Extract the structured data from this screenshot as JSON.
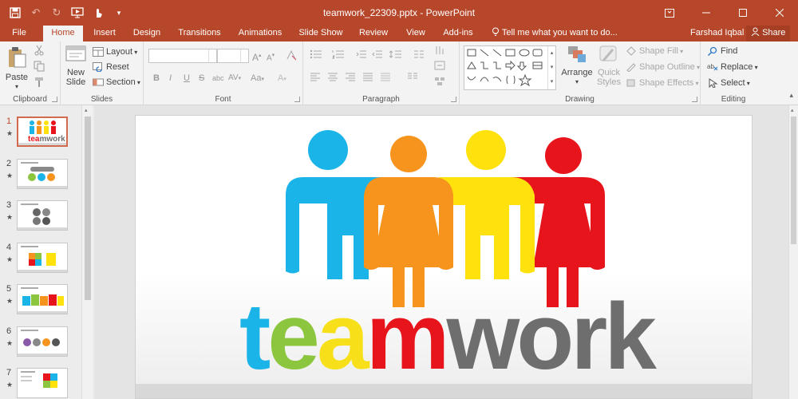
{
  "window": {
    "title": "teamwork_22309.pptx - PowerPoint",
    "controls": [
      "ribbon-display-icon",
      "minimize-icon",
      "restore-icon",
      "close-icon"
    ]
  },
  "quick_access": [
    "save-icon",
    "undo-icon",
    "redo-icon",
    "start-from-beginning-icon",
    "touch-mode-icon",
    "customize-icon"
  ],
  "tabs": [
    {
      "label": "File",
      "active": false
    },
    {
      "label": "Home",
      "active": true
    },
    {
      "label": "Insert",
      "active": false
    },
    {
      "label": "Design",
      "active": false
    },
    {
      "label": "Transitions",
      "active": false
    },
    {
      "label": "Animations",
      "active": false
    },
    {
      "label": "Slide Show",
      "active": false
    },
    {
      "label": "Review",
      "active": false
    },
    {
      "label": "View",
      "active": false
    },
    {
      "label": "Add-ins",
      "active": false
    }
  ],
  "tell_me": "Tell me what you want to do...",
  "user_name": "Farshad Iqbal",
  "share_label": "Share",
  "ribbon": {
    "clipboard": {
      "label": "Clipboard",
      "paste": "Paste"
    },
    "slides": {
      "label": "Slides",
      "new_slide_1": "New",
      "new_slide_2": "Slide",
      "layout": "Layout",
      "reset": "Reset",
      "section": "Section"
    },
    "font": {
      "label": "Font",
      "font_name": "",
      "font_size": "",
      "bold": "B",
      "italic": "I",
      "underline": "U",
      "strike": "S",
      "shadow": "abc",
      "spacing": "AV",
      "case": "Aa"
    },
    "paragraph": {
      "label": "Paragraph"
    },
    "drawing": {
      "label": "Drawing",
      "arrange": "Arrange",
      "quick_styles_1": "Quick",
      "quick_styles_2": "Styles",
      "shape_fill": "Shape Fill",
      "shape_outline": "Shape Outline",
      "shape_effects": "Shape Effects"
    },
    "editing": {
      "label": "Editing",
      "find": "Find",
      "replace": "Replace",
      "select": "Select"
    }
  },
  "thumbnails": [
    {
      "num": "1",
      "selected": true
    },
    {
      "num": "2",
      "selected": false
    },
    {
      "num": "3",
      "selected": false
    },
    {
      "num": "4",
      "selected": false
    },
    {
      "num": "5",
      "selected": false
    },
    {
      "num": "6",
      "selected": false
    },
    {
      "num": "7",
      "selected": false
    }
  ],
  "slide": {
    "word": "teamwork",
    "colors": {
      "t": "#1ab4e8",
      "e": "#8cc63f",
      "a": "#f7e01a",
      "m": "#e8141c",
      "work": "#6e6e6e"
    },
    "people": [
      {
        "color": "#1ab4e8",
        "figure": "man"
      },
      {
        "color": "#f7941d",
        "figure": "woman"
      },
      {
        "color": "#ffe20d",
        "figure": "man"
      },
      {
        "color": "#e8141c",
        "figure": "woman"
      }
    ]
  },
  "colors": {
    "accent": "#b7472a"
  }
}
